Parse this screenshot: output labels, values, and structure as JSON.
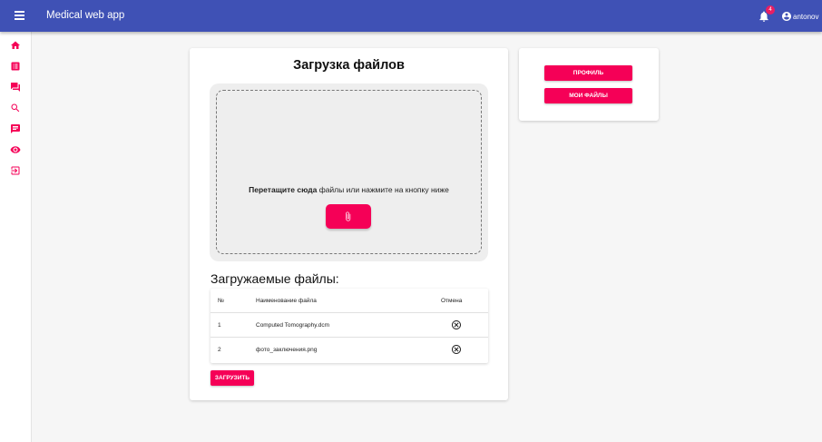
{
  "app": {
    "title": "Medical web app",
    "notification_count": "4",
    "username": "antonov",
    "brand_color": "#3f51b5",
    "accent_color": "#f50057"
  },
  "sidebar": {
    "items": [
      {
        "icon": "home-icon"
      },
      {
        "icon": "list-alt-icon"
      },
      {
        "icon": "forum-icon"
      },
      {
        "icon": "search-icon"
      },
      {
        "icon": "chat-icon"
      },
      {
        "icon": "eye-icon"
      },
      {
        "icon": "logout-icon"
      }
    ]
  },
  "upload": {
    "title": "Загрузка файлов",
    "drop_bold": "Перетащите сюда",
    "drop_rest": " файлы или нажмите на кнопку ниже",
    "attach_icon": "paperclip-icon"
  },
  "files": {
    "title": "Загружаемые файлы:",
    "columns": [
      "№",
      "Наименование файла",
      "Отмена"
    ],
    "rows": [
      {
        "num": "1",
        "name": "Computed Tomography.dcm"
      },
      {
        "num": "2",
        "name": "фото_заключения.png"
      }
    ],
    "submit_label": "ЗАГРУЗИТЬ"
  },
  "side_card": {
    "profile_label": "ПРОФИЛЬ",
    "my_files_label": "МОИ ФАЙЛЫ"
  }
}
